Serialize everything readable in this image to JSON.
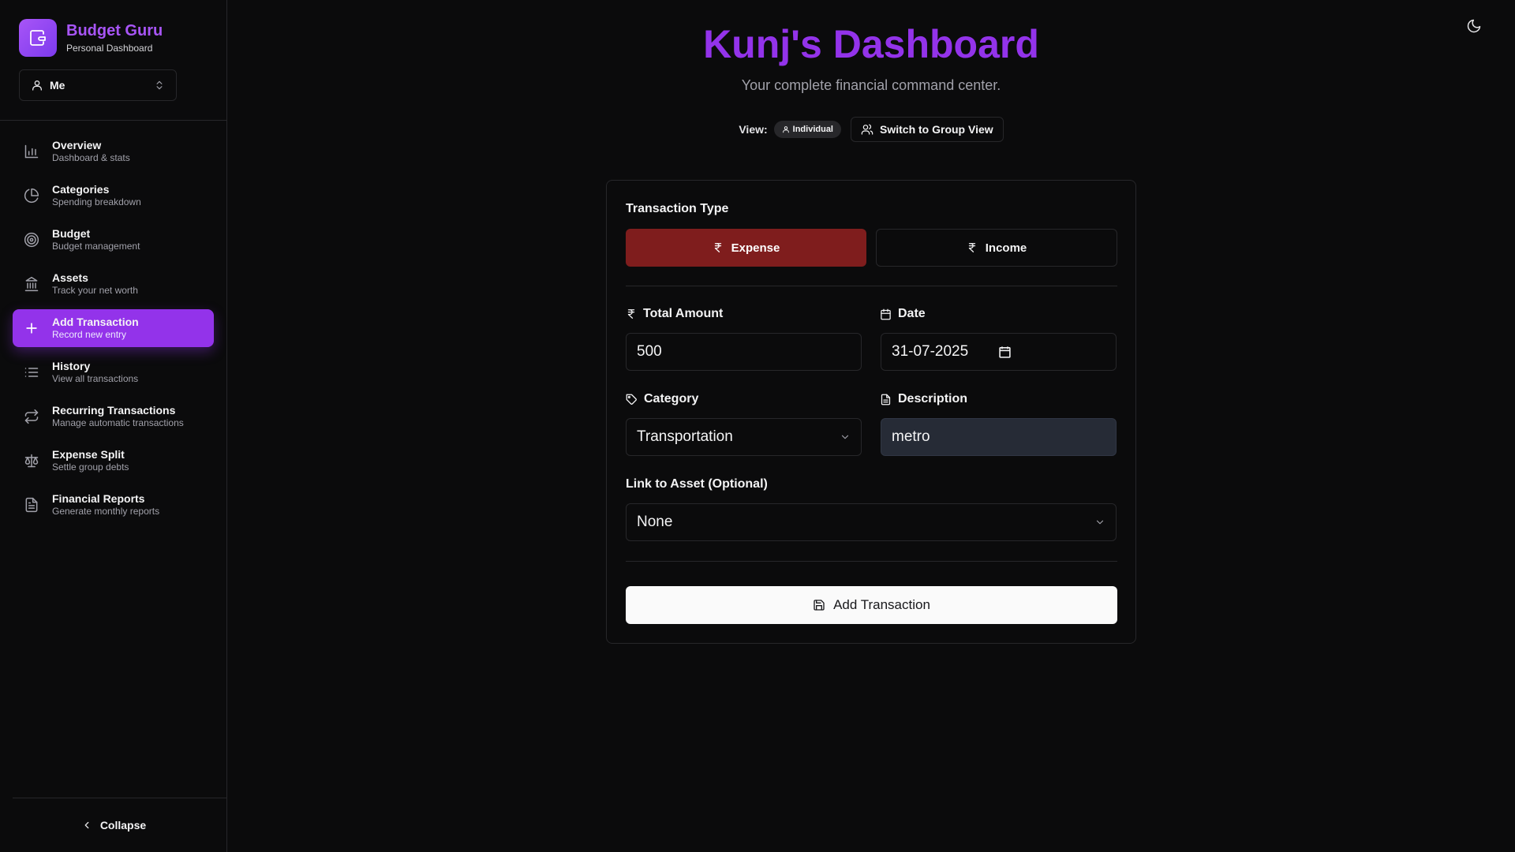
{
  "app": {
    "name": "Budget Guru",
    "subtitle": "Personal Dashboard",
    "accent": "#9333ea"
  },
  "profile_select": {
    "value": "Me"
  },
  "sidebar": {
    "items": [
      {
        "title": "Overview",
        "subtitle": "Dashboard & stats",
        "icon": "bar-chart-icon",
        "active": false
      },
      {
        "title": "Categories",
        "subtitle": "Spending breakdown",
        "icon": "pie-chart-icon",
        "active": false
      },
      {
        "title": "Budget",
        "subtitle": "Budget management",
        "icon": "target-icon",
        "active": false
      },
      {
        "title": "Assets",
        "subtitle": "Track your net worth",
        "icon": "bank-icon",
        "active": false
      },
      {
        "title": "Add Transaction",
        "subtitle": "Record new entry",
        "icon": "plus-icon",
        "active": true
      },
      {
        "title": "History",
        "subtitle": "View all transactions",
        "icon": "list-icon",
        "active": false
      },
      {
        "title": "Recurring Transactions",
        "subtitle": "Manage automatic transactions",
        "icon": "repeat-icon",
        "active": false
      },
      {
        "title": "Expense Split",
        "subtitle": "Settle group debts",
        "icon": "scale-icon",
        "active": false
      },
      {
        "title": "Financial Reports",
        "subtitle": "Generate monthly reports",
        "icon": "file-text-icon",
        "active": false
      }
    ],
    "collapse_label": "Collapse"
  },
  "header": {
    "title": "Kunj's Dashboard",
    "subtitle": "Your complete financial command center.",
    "view_label": "View:",
    "view_badge": "Individual",
    "switch_label": "Switch to Group View"
  },
  "form": {
    "transaction_type_label": "Transaction Type",
    "expense_label": "Expense",
    "income_label": "Income",
    "selected_type": "Expense",
    "expense_color": "#7f1d1d",
    "amount_label": "Total Amount",
    "amount_value": "500",
    "date_label": "Date",
    "date_value": "31-07-2025",
    "category_label": "Category",
    "category_value": "Transportation",
    "description_label": "Description",
    "description_value": "metro",
    "asset_label": "Link to Asset (Optional)",
    "asset_value": "None",
    "submit_label": "Add Transaction"
  }
}
